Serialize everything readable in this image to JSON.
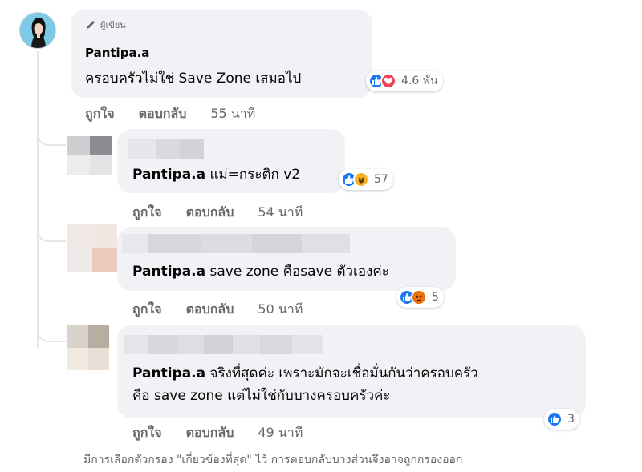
{
  "comments": [
    {
      "author_badge": "ผู้เขียน",
      "author": "Pantipa.a",
      "text": "ครอบครัวไม่ใช่ Save Zone เสมอไป",
      "reaction_count": "4.6 พัน",
      "like_label": "ถูกใจ",
      "reply_label": "ตอบกลับ",
      "time": "55 นาที"
    },
    {
      "mention": "Pantipa.a",
      "text": " แม่=กระติก v2",
      "reaction_count": "57",
      "like_label": "ถูกใจ",
      "reply_label": "ตอบกลับ",
      "time": "54 นาที"
    },
    {
      "mention": "Pantipa.a",
      "text": " save zone คือsave ตัวเองค่ะ",
      "reaction_count": "5",
      "like_label": "ถูกใจ",
      "reply_label": "ตอบกลับ",
      "time": "50 นาที"
    },
    {
      "mention": "Pantipa.a",
      "text_line1": " จริงที่สุดค่ะ เพราะมักจะเชื่อมั่นกันว่าครอบครัว",
      "text_line2": "คือ save zone แต่ไม่ใช่กับบางครอบครัวค่ะ",
      "reaction_count": "3",
      "like_label": "ถูกใจ",
      "reply_label": "ตอบกลับ",
      "time": "49 นาที"
    }
  ],
  "footer_note": "มีการเลือกตัวกรอง \"เกี่ยวข้องที่สุด\" ไว้ การตอบกลับบางส่วนจึงอาจถูกกรองออก",
  "colors": {
    "bubble": "#f0f2f5",
    "secondary_text": "#65676b",
    "like": "#1877f2",
    "love": "#f33e58"
  },
  "icons": [
    "pen-icon",
    "like-reaction-icon",
    "love-reaction-icon",
    "haha-reaction-icon",
    "angry-reaction-icon"
  ]
}
